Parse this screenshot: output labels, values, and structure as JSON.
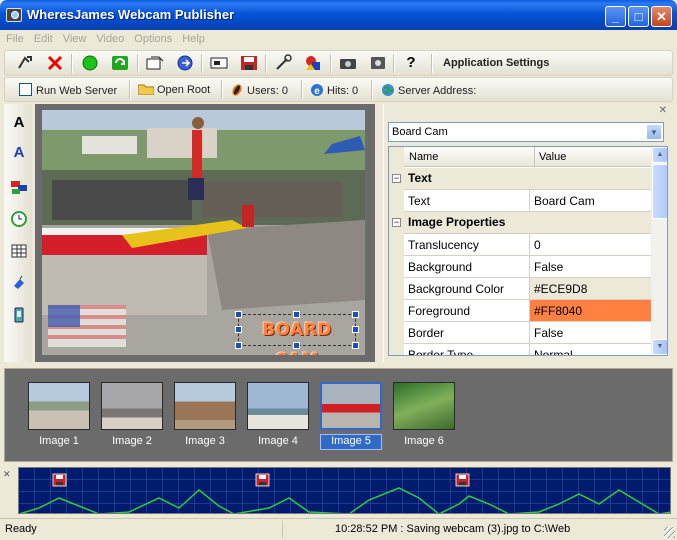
{
  "window": {
    "title": "WheresJames Webcam Publisher"
  },
  "menu": [
    "File",
    "Edit",
    "View",
    "Video",
    "Options",
    "Help"
  ],
  "toolbar": {
    "settings_label": "Application Settings"
  },
  "toolbar2": {
    "run_web_server": "Run Web Server",
    "open_root": "Open Root",
    "users": "Users: 0",
    "hits": "Hits: 0",
    "server_address": "Server Address:"
  },
  "preview": {
    "overlay_text": "BOARD CAM"
  },
  "properties": {
    "combo_value": "Board Cam",
    "columns": {
      "name": "Name",
      "value": "Value"
    },
    "cat_text": "Text",
    "cat_image": "Image Properties",
    "rows": [
      {
        "name": "Text",
        "value": "Board Cam"
      },
      {
        "name": "Translucency",
        "value": "0"
      },
      {
        "name": "Background",
        "value": "False"
      },
      {
        "name": "Background Color",
        "value": "#ECE9D8"
      },
      {
        "name": "Foreground",
        "value": "#FF8040"
      },
      {
        "name": "Border",
        "value": "False"
      },
      {
        "name": "Border Type",
        "value": "Normal"
      }
    ]
  },
  "thumbnails": [
    "Image 1",
    "Image 2",
    "Image 3",
    "Image 4",
    "Image 5",
    "Image 6"
  ],
  "selected_thumbnail": "Image 5",
  "status": {
    "left": "Ready",
    "message": "10:28:52 PM : Saving webcam (3).jpg to C:\\Web"
  },
  "colors": {
    "foreground_swatch": "#FF8040",
    "selection": "#316AC5",
    "graph_line": "#2ECC40"
  }
}
